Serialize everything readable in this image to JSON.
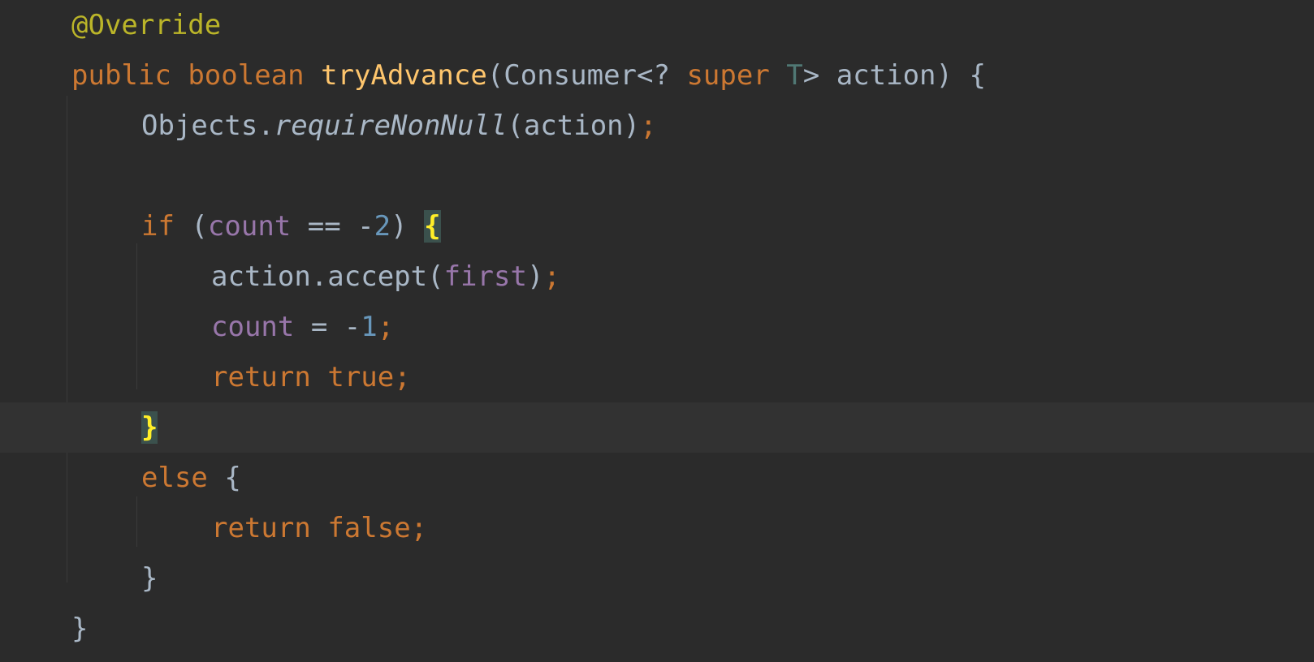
{
  "editor": {
    "colors": {
      "background": "#2b2b2b",
      "current_line": "#323232",
      "keyword": "#cc7832",
      "annotation": "#bbb529",
      "method_declaration": "#ffc66d",
      "field": "#9876aa",
      "number": "#6897bb",
      "type_parameter": "#507874",
      "default_text": "#a9b7c6",
      "brace_match_bg": "#3b514d",
      "brace_match_fg": "#ffef28"
    },
    "lines": [
      {
        "tokens": [
          "@Override"
        ]
      },
      {
        "tokens": [
          "public",
          " ",
          "boolean",
          " ",
          "tryAdvance",
          "(Consumer<? ",
          "super",
          " ",
          "T",
          "> action) {"
        ]
      },
      {
        "tokens": [
          "Objects.",
          "requireNonNull",
          "(action)",
          ";"
        ]
      },
      {
        "tokens": []
      },
      {
        "tokens": [
          "if",
          " (",
          "count",
          " == -",
          "2",
          ") ",
          "{"
        ]
      },
      {
        "tokens": [
          "action.accept(",
          "first",
          ")",
          ";"
        ]
      },
      {
        "tokens": [
          "count",
          " = -",
          "1",
          ";"
        ]
      },
      {
        "tokens": [
          "return",
          " ",
          "true",
          ";"
        ]
      },
      {
        "tokens": [
          "}"
        ]
      },
      {
        "tokens": [
          "else",
          " {"
        ]
      },
      {
        "tokens": [
          "return",
          " ",
          "false",
          ";"
        ]
      },
      {
        "tokens": [
          "}"
        ]
      },
      {
        "tokens": [
          "}"
        ]
      }
    ]
  }
}
